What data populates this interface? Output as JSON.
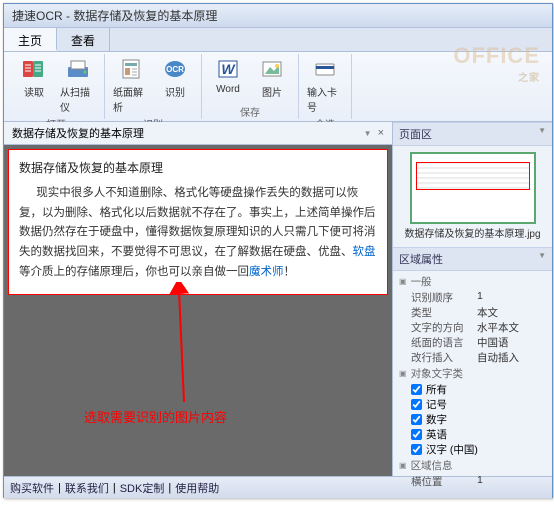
{
  "window": {
    "title": "捷速OCR - 数据存储及恢复的基本原理"
  },
  "tabs": [
    {
      "label": "主页",
      "active": true
    },
    {
      "label": "查看",
      "active": false
    }
  ],
  "ribbon": {
    "groups": [
      {
        "label": "打开",
        "buttons": [
          {
            "label": "读取",
            "icon": "read"
          },
          {
            "label": "从扫描仪",
            "icon": "scanner"
          }
        ]
      },
      {
        "label": "识别",
        "buttons": [
          {
            "label": "纸面解析",
            "icon": "page"
          },
          {
            "label": "识别",
            "icon": "ocr"
          }
        ]
      },
      {
        "label": "保存",
        "buttons": [
          {
            "label": "Word",
            "icon": "word"
          },
          {
            "label": "图片",
            "icon": "image"
          }
        ]
      },
      {
        "label": "全选",
        "buttons": [
          {
            "label": "输入卡号",
            "icon": "card"
          }
        ]
      }
    ]
  },
  "doc_tab": {
    "title": "数据存储及恢复的基本原理",
    "close": "×"
  },
  "document": {
    "title": "数据存储及恢复的基本原理",
    "body_pre": "现实中很多人不知道删除、格式化等硬盘操作丢失的数据可以恢复，以为删除、格式化以后数据就不存在了。事实上，上述简单操作后数据仍然存在于硬盘中，懂得数据恢复原理知识的人只需几下便可将消失的数据找回来，不要觉得不可思议，在了解数据在硬盘、优盘、",
    "link1": "软盘",
    "body_mid": "等介质上的存储原理后，你也可以亲自做一回",
    "link2": "魔术师",
    "body_post": "！"
  },
  "annotation": "选取需要识别的图片内容",
  "right": {
    "pages_title": "页面区",
    "thumb_label": "数据存储及恢复的基本原理.jpg",
    "props_title": "区域属性",
    "general_label": "一般",
    "rows": [
      {
        "k": "识别顺序",
        "v": "1"
      },
      {
        "k": "类型",
        "v": "本文"
      },
      {
        "k": "文字的方向",
        "v": "水平本文"
      },
      {
        "k": "纸面的语言",
        "v": "中国语"
      },
      {
        "k": "改行插入",
        "v": "自动插入"
      }
    ],
    "chars_label": "对象文字类",
    "checks": [
      {
        "label": "所有",
        "checked": true
      },
      {
        "label": "记号",
        "checked": true
      },
      {
        "label": "数字",
        "checked": true
      },
      {
        "label": "英语",
        "checked": true
      },
      {
        "label": "汉字 (中国)",
        "checked": true
      }
    ],
    "region_label": "区域信息",
    "region_rows": [
      {
        "k": "横位置",
        "v": "1"
      }
    ]
  },
  "status": {
    "links": [
      "购买软件",
      "联系我们",
      "SDK定制",
      "使用帮助"
    ]
  },
  "watermark": {
    "main": "OFFICE",
    "sub": "之家"
  }
}
